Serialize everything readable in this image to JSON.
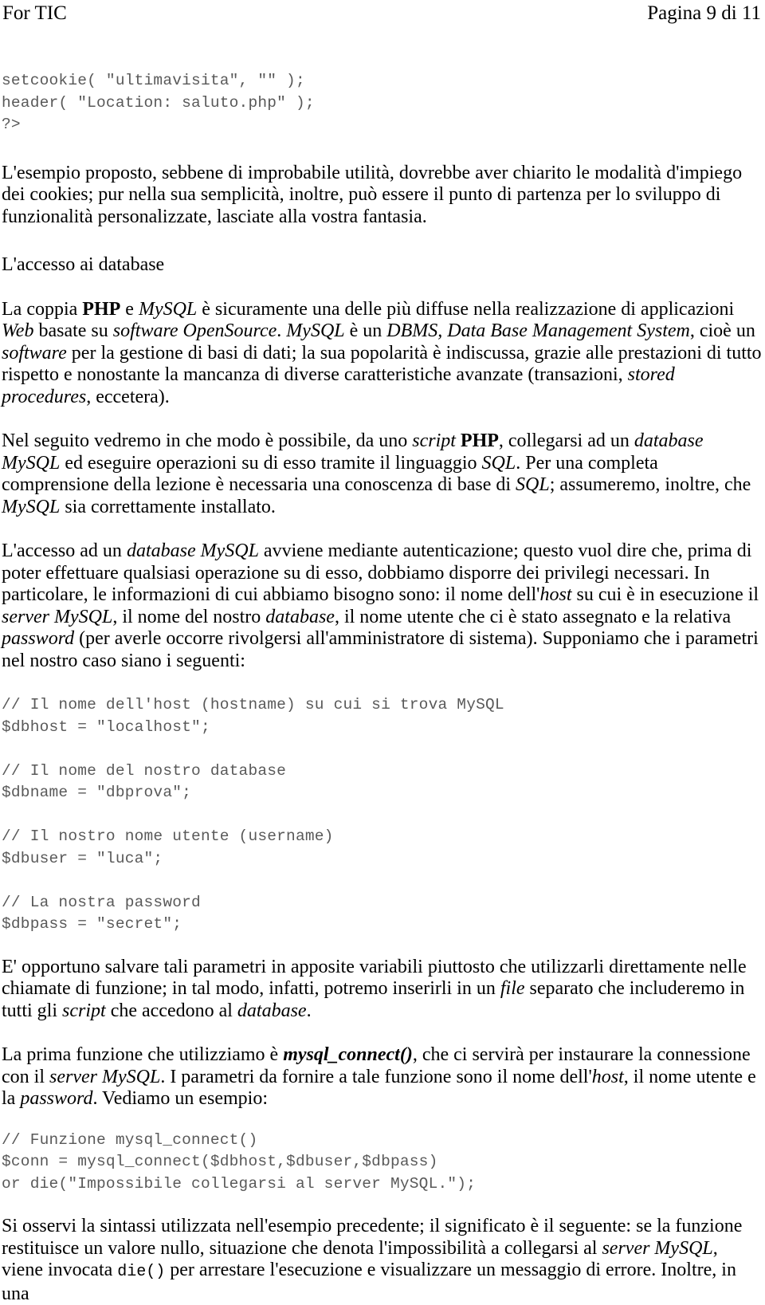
{
  "header": {
    "left": "For TIC",
    "right": "Pagina 9 di 11"
  },
  "code_blocks": {
    "block1": "setcookie( \"ultimavisita\", \"\" );\nheader( \"Location: saluto.php\" );\n?>",
    "block2": "// Il nome dell'host (hostname) su cui si trova MySQL\n$dbhost = \"localhost\";\n\n// Il nome del nostro database\n$dbname = \"dbprova\";\n\n// Il nostro nome utente (username)\n$dbuser = \"luca\";\n\n// La nostra password\n$dbpass = \"secret\";",
    "block3": "// Funzione mysql_connect()\n$conn = mysql_connect($dbhost,$dbuser,$dbpass)\nor die(\"Impossibile collegarsi al server MySQL.\");"
  },
  "headings": {
    "accesso_db": "L'accesso ai database"
  },
  "paragraphs": {
    "p1": "L'esempio proposto, sebbene di improbabile utilità, dovrebbe aver chiarito le modalità d'impiego dei cookies; pur nella sua semplicità, inoltre, può essere il punto di partenza per lo sviluppo di funzionalità personalizzate, lasciate alla vostra fantasia.",
    "p2": {
      "t1": "La coppia ",
      "b1": "PHP",
      "t2": " e ",
      "i1": "MySQL",
      "t3": " è sicuramente una delle più diffuse nella realizzazione di applicazioni ",
      "i2": "Web",
      "t4": " basate su ",
      "i3": "software OpenSource",
      "t5": ". ",
      "i4": "MySQL",
      "t6": " è un ",
      "i5": "DBMS, Data Base Management System",
      "t7": ", cioè un ",
      "i6": "software",
      "t8": " per la gestione di basi di dati; la sua popolarità è indiscussa, grazie alle prestazioni di tutto rispetto e nonostante la mancanza di diverse caratteristiche avanzate (transazioni, ",
      "i7": "stored procedures",
      "t9": ", eccetera)."
    },
    "p3": {
      "t1": "Nel seguito vedremo in che modo è possibile, da uno ",
      "i1": "script",
      "t2": " ",
      "b1": "PHP",
      "t3": ", collegarsi ad un ",
      "i2": "database MySQL",
      "t4": " ed eseguire operazioni su di esso tramite il linguaggio ",
      "i3": "SQL",
      "t5": ". Per una completa comprensione della lezione è necessaria una conoscenza di base di ",
      "i4": "SQL",
      "t6": "; assumeremo, inoltre, che ",
      "i5": "MySQL",
      "t7": " sia correttamente installato."
    },
    "p4": {
      "t1": "L'accesso ad un ",
      "i1": "database MySQL",
      "t2": " avviene mediante autenticazione; questo vuol dire che, prima di poter effettuare qualsiasi operazione su di esso, dobbiamo disporre dei privilegi necessari. In particolare, le informazioni di cui abbiamo bisogno sono: il nome dell'",
      "i2": "host",
      "t3": " su cui è in esecuzione il ",
      "i3": "server MySQL",
      "t4": ", il nome del nostro ",
      "i4": "database",
      "t5": ", il nome utente che ci è stato assegnato e la relativa ",
      "i5": "password",
      "t6": " (per averle occorre rivolgersi all'amministratore di sistema). Supponiamo che i parametri nel nostro caso siano i seguenti:"
    },
    "p5": {
      "t1": "E' opportuno salvare tali parametri in apposite variabili piuttosto che utilizzarli direttamente nelle chiamate di funzione; in tal modo, infatti, potremo inserirli in un ",
      "i1": "file",
      "t2": " separato che includeremo in tutti gli ",
      "i2": "script",
      "t3": " che accedono al ",
      "i3": "database",
      "t4": "."
    },
    "p6": {
      "t1": "La prima funzione che utilizziamo è ",
      "bi1": "mysql_connect()",
      "t2": ", che ci servirà per instaurare la connessione con il ",
      "i1": "server MySQL",
      "t3": ". I parametri da fornire a tale funzione sono il nome dell'",
      "i2": "host",
      "t4": ", il nome utente e la ",
      "i3": "password",
      "t5": ". Vediamo un esempio:"
    },
    "p7": {
      "t1": "Si osservi la sintassi utilizzata nell'esempio precedente; il significato è il seguente: se la funzione restituisce un valore nullo, situazione che denota l'impossibilità a collegarsi al ",
      "i1": "server MySQL",
      "t2": ", viene invocata ",
      "m1": "die()",
      "t3": " per arrestare l'esecuzione e visualizzare un messaggio di errore. Inoltre, in una"
    }
  }
}
